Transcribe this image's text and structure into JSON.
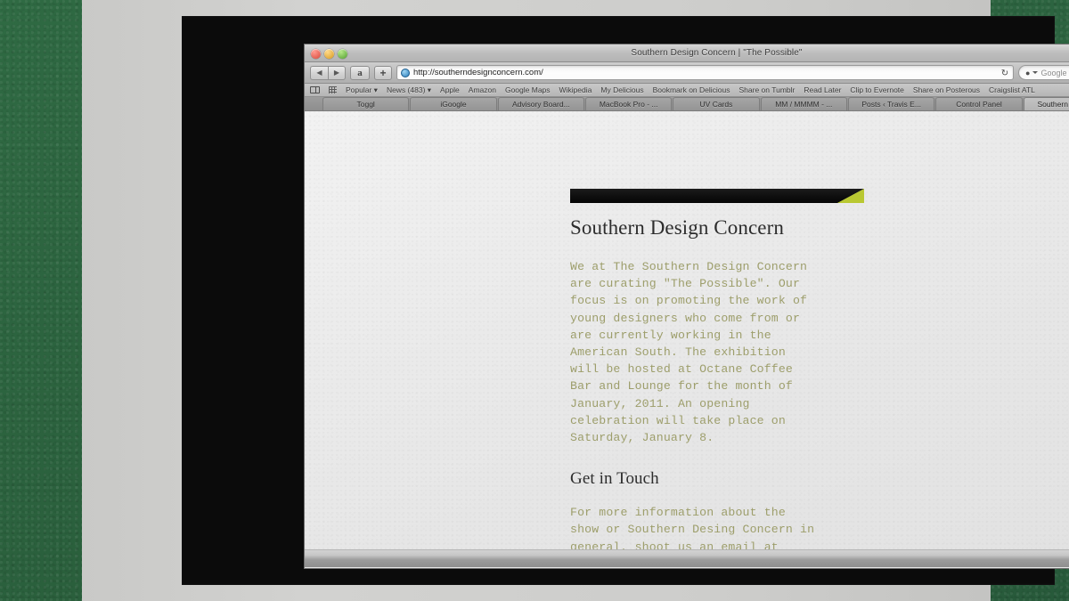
{
  "window": {
    "title": "Southern Design Concern | \"The Possible\"",
    "traffic_lights": [
      "close",
      "minimize",
      "maximize"
    ]
  },
  "toolbar": {
    "back_label": "◀",
    "forward_label": "▶",
    "amazon_label": "a",
    "plus_label": "+",
    "url": "http://southerndesignconcern.com/",
    "reload_label": "↻",
    "search_glyph": "🔍",
    "search_placeholder": "Google"
  },
  "bookmarks": {
    "items": [
      "Popular ▾",
      "News (483) ▾",
      "Apple",
      "Amazon",
      "Google Maps",
      "Wikipedia",
      "My Delicious",
      "Bookmark on Delicious",
      "Share on Tumblr",
      "Read Later",
      "Clip to Evernote",
      "Share on Posterous",
      "Craigslist ATL"
    ],
    "overflow_label": "»"
  },
  "tabs": {
    "items": [
      {
        "label": "Toggl",
        "active": false
      },
      {
        "label": "iGoogle",
        "active": false
      },
      {
        "label": "Advisory Board...",
        "active": false
      },
      {
        "label": "MacBook Pro - ...",
        "active": false
      },
      {
        "label": "UV Cards",
        "active": false
      },
      {
        "label": "MM / MMMM - ...",
        "active": false
      },
      {
        "label": "Posts ‹ Travis E...",
        "active": false
      },
      {
        "label": "Control Panel",
        "active": false
      },
      {
        "label": "Southern Desig...",
        "active": true
      }
    ],
    "new_tab_label": "+"
  },
  "page": {
    "heading": "Southern Design Concern",
    "intro": "We at The Southern Design Concern\nare curating \"The Possible\". Our\nfocus is on promoting the work of\nyoung designers who come from or\nare currently working in the\nAmerican South. The exhibition\nwill be hosted at Octane Coffee\nBar and Lounge for the month of\nJanuary, 2011. An opening\ncelebration will take place on\nSaturday, January 8.",
    "contact_heading": "Get in Touch",
    "contact_text": "For more information about the\nshow or Southern Desing Concern in\ngeneral, shoot us an email at\ninfo@southerndesignconcern.com"
  },
  "colors": {
    "desktop_green": "#2c6440",
    "frame_gray": "#cdcdcb",
    "bezel_black": "#0b0b0b",
    "banner_black": "#0d0d0d",
    "banner_accent": "#b9c832",
    "body_text_olive": "#9d9e6b",
    "heading_dark": "#2d2d2d",
    "page_background": "#ebebeb"
  }
}
